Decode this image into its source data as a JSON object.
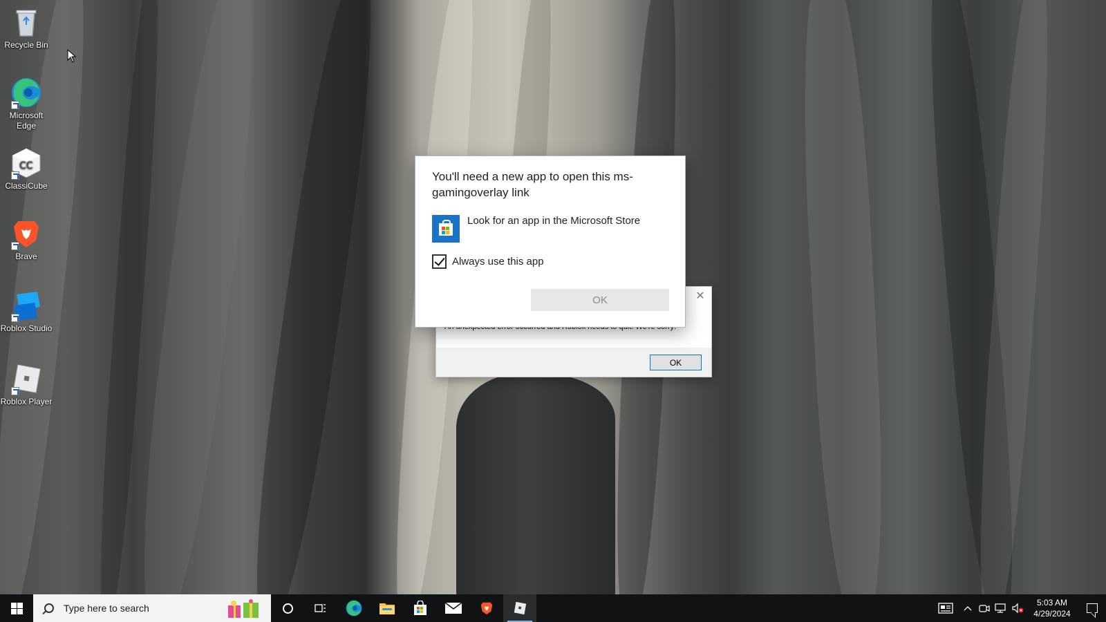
{
  "desktop": {
    "icons": [
      {
        "label": "Recycle Bin",
        "icon": "recycle-bin-icon"
      },
      {
        "label": "Microsoft Edge",
        "icon": "edge-icon"
      },
      {
        "label": "ClassiCube",
        "icon": "classicube-icon"
      },
      {
        "label": "Brave",
        "icon": "brave-icon"
      },
      {
        "label": "Roblox Studio",
        "icon": "roblox-studio-icon"
      },
      {
        "label": "Roblox Player",
        "icon": "roblox-player-icon"
      }
    ]
  },
  "open_with_dialog": {
    "title": "You'll need a new app to open this ms-gamingoverlay link",
    "store_option": "Look for an app in the Microsoft Store",
    "always_use_label": "Always use this app",
    "always_use_checked": true,
    "ok_label": "OK"
  },
  "error_dialog": {
    "message": "An unexpected error occurred and Roblox needs to quit.  We're sorry!",
    "ok_label": "OK",
    "close_glyph": "✕"
  },
  "taskbar": {
    "search_placeholder": "Type here to search",
    "pinned": [
      "edge-icon",
      "file-explorer-icon",
      "microsoft-store-icon",
      "mail-icon",
      "brave-icon",
      "roblox-player-icon"
    ],
    "clock_time": "5:03 AM",
    "clock_date": "4/29/2024"
  },
  "colors": {
    "accent": "#0078d7",
    "store_tile": "#1a73c8",
    "taskbar_bg": "#101214"
  }
}
